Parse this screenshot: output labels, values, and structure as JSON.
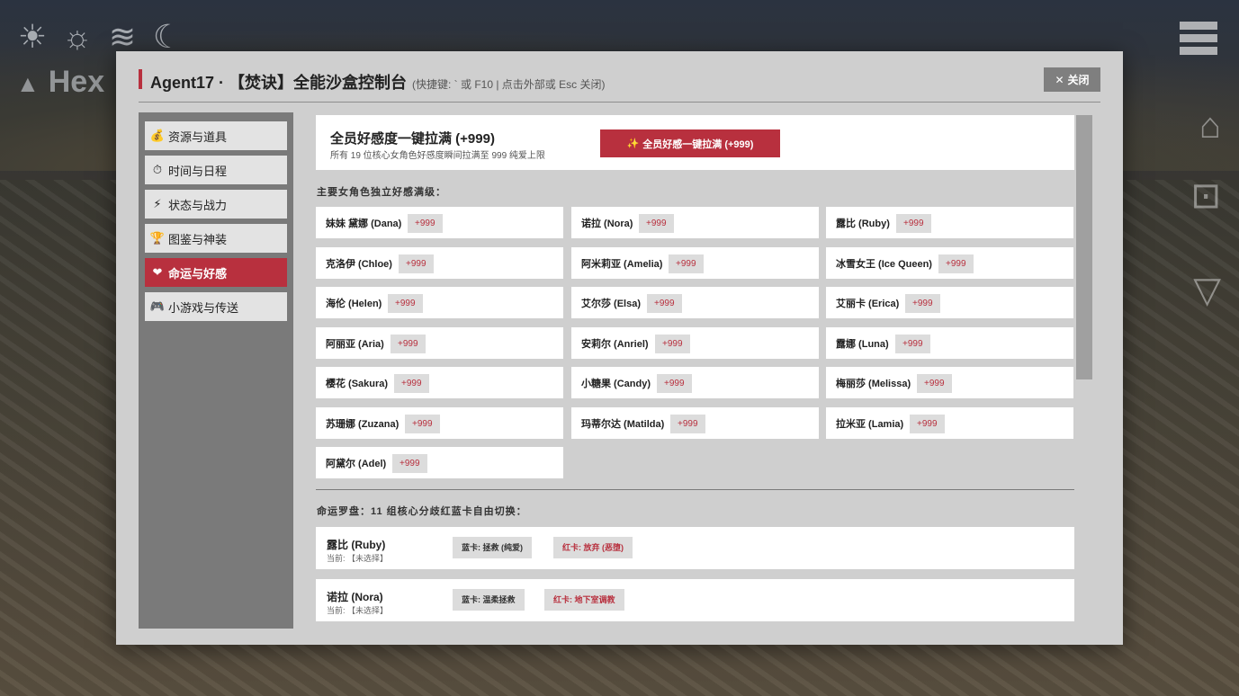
{
  "header": {
    "title": "Agent17 · 【焚诀】全能沙盒控制台",
    "hint": "(快捷键: ` 或 F10 | 点击外部或 Esc 关闭)",
    "close_label": "关闭"
  },
  "hud": {
    "weather_icons": [
      "sunrise-icon",
      "sun-icon",
      "fog-icon",
      "moon-icon"
    ],
    "hex_text": "Hex"
  },
  "sidebar": {
    "items": [
      {
        "label": "资源与道具",
        "icon": "money-bag-icon",
        "glyph": "💰",
        "active": false
      },
      {
        "label": "时间与日程",
        "icon": "clock-icon",
        "glyph": "⏱",
        "active": false
      },
      {
        "label": "状态与战力",
        "icon": "lightning-icon",
        "glyph": "⚡",
        "active": false
      },
      {
        "label": "图鉴与神装",
        "icon": "trophy-icon",
        "glyph": "🏆",
        "active": false
      },
      {
        "label": "命运与好感",
        "icon": "heart-icon",
        "glyph": "❤",
        "active": true
      },
      {
        "label": "小游戏与传送",
        "icon": "gamepad-icon",
        "glyph": "🎮",
        "active": false
      }
    ]
  },
  "main": {
    "top_card": {
      "heading": "全员好感度一键拉满 (+999)",
      "subtitle": "所有 19 位核心女角色好感度瞬间拉满至 999 纯爱上限",
      "button_label": "全员好感一键拉满 (+999)"
    },
    "characters_label": "主要女角色独立好感满级：",
    "plus_label": "+999",
    "characters": [
      "妹妹 黛娜 (Dana)",
      "诺拉 (Nora)",
      "露比 (Ruby)",
      "克洛伊 (Chloe)",
      "阿米莉亚 (Amelia)",
      "冰雪女王 (Ice Queen)",
      "海伦 (Helen)",
      "艾尔莎 (Elsa)",
      "艾丽卡 (Erica)",
      "阿丽亚 (Aria)",
      "安莉尔 (Anriel)",
      "露娜 (Luna)",
      "樱花 (Sakura)",
      "小糖果 (Candy)",
      "梅丽莎 (Melissa)",
      "苏珊娜 (Zuzana)",
      "玛蒂尔达 (Matilda)",
      "拉米亚 (Lamia)",
      "阿黛尔 (Adel)"
    ],
    "fate_label": "命运罗盘：11 组核心分歧红蓝卡自由切换：",
    "fate_rows": [
      {
        "name": "露比 (Ruby)",
        "current": "当前: 【未选择】",
        "blue": "蓝卡: 拯救 (纯爱)",
        "red": "红卡: 放弃 (恶堕)"
      },
      {
        "name": "诺拉 (Nora)",
        "current": "当前: 【未选择】",
        "blue": "蓝卡: 温柔拯救",
        "red": "红卡: 地下室调教"
      }
    ]
  },
  "colors": {
    "accent": "#b8303e",
    "panel": "#cfcfcf",
    "sidebar": "#7a7a7a"
  }
}
